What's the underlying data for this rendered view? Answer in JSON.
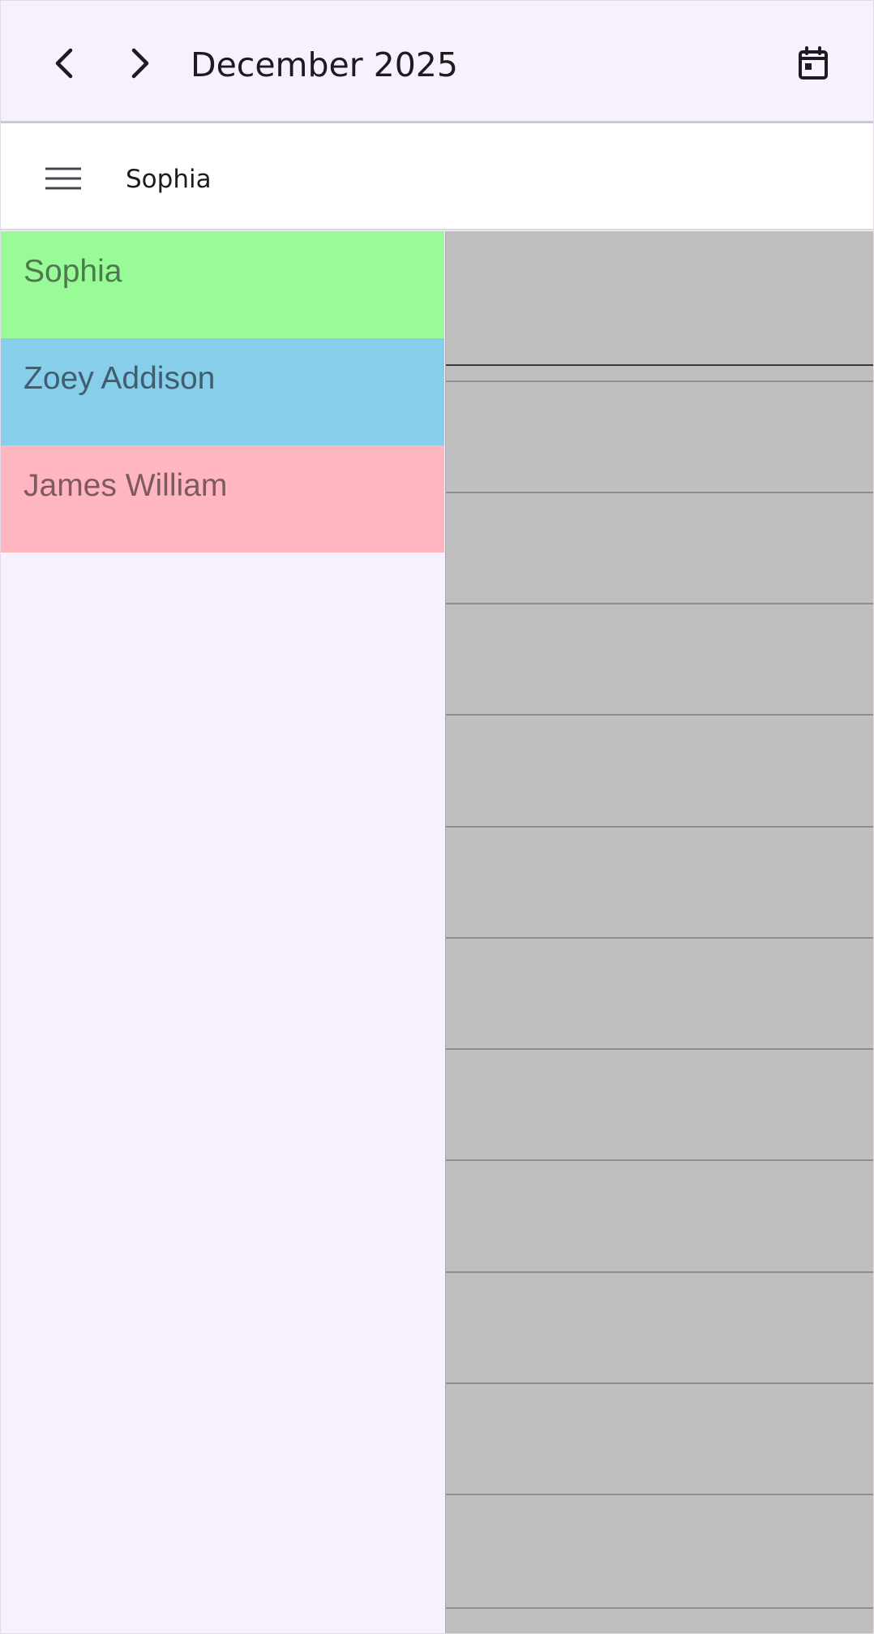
{
  "header": {
    "title": "December 2025",
    "prev_icon": "chevron-left-icon",
    "next_icon": "chevron-right-icon",
    "calendar_icon": "calendar-today-icon"
  },
  "subheader": {
    "menu_icon": "hamburger-menu-icon",
    "selected_resource": "Sophia"
  },
  "resources": [
    {
      "name": "Sophia",
      "color": "#98fb98",
      "text_color": "#4d7a4d"
    },
    {
      "name": "Zoey Addison",
      "color": "#87ceeb",
      "text_color": "#3f5e70"
    },
    {
      "name": "James William",
      "color": "#ffb6c1",
      "text_color": "#7d5a60"
    }
  ],
  "colors": {
    "background": "#f7f1fd",
    "timeline": "#bfbfbf",
    "now_indicator": "#3b3845"
  }
}
